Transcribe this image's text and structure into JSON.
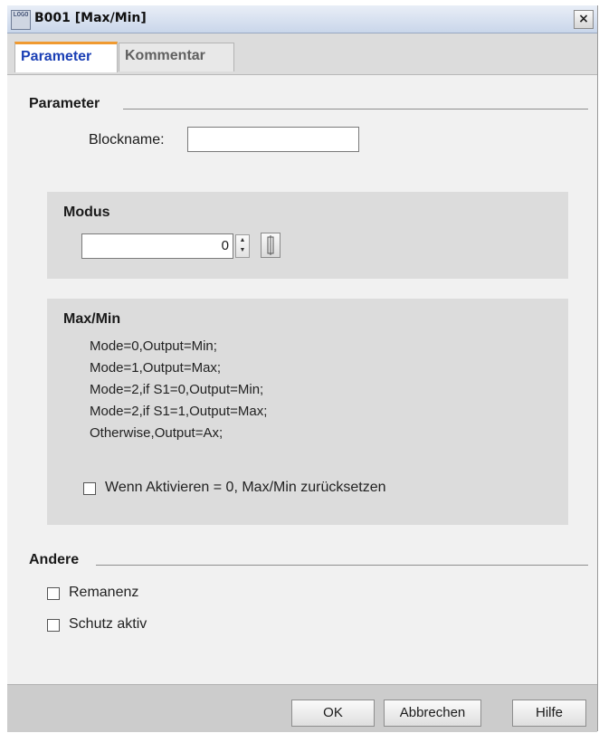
{
  "window": {
    "icon_text": "LOGO",
    "title": "B001 [Max/Min]",
    "close_glyph": "×"
  },
  "tabs": [
    {
      "label": "Parameter",
      "active": true
    },
    {
      "label": "Kommentar",
      "active": false
    }
  ],
  "parameter_section": {
    "title": "Parameter",
    "blockname_label": "Blockname:",
    "blockname_value": ""
  },
  "modus": {
    "title": "Modus",
    "value": "0",
    "spin_up": "▲",
    "spin_down": "▼"
  },
  "maxmin": {
    "title": "Max/Min",
    "lines": [
      "Mode=0,Output=Min;",
      "Mode=1,Output=Max;",
      "Mode=2,if S1=0,Output=Min;",
      "Mode=2,if S1=1,Output=Max;",
      "Otherwise,Output=Ax;"
    ],
    "reset_checkbox_label": "Wenn Aktivieren = 0, Max/Min zurücksetzen",
    "reset_checked": false
  },
  "andere": {
    "title": "Andere",
    "remanenz_label": "Remanenz",
    "remanenz_checked": false,
    "schutz_label": "Schutz aktiv",
    "schutz_checked": false
  },
  "buttons": {
    "ok": "OK",
    "cancel": "Abbrechen",
    "help": "Hilfe"
  },
  "colors": {
    "active_tab_text": "#1a3fb5",
    "active_tab_accent": "#f09a30",
    "group_background": "#dcdcdc",
    "dialog_background": "#f1f1f1"
  }
}
